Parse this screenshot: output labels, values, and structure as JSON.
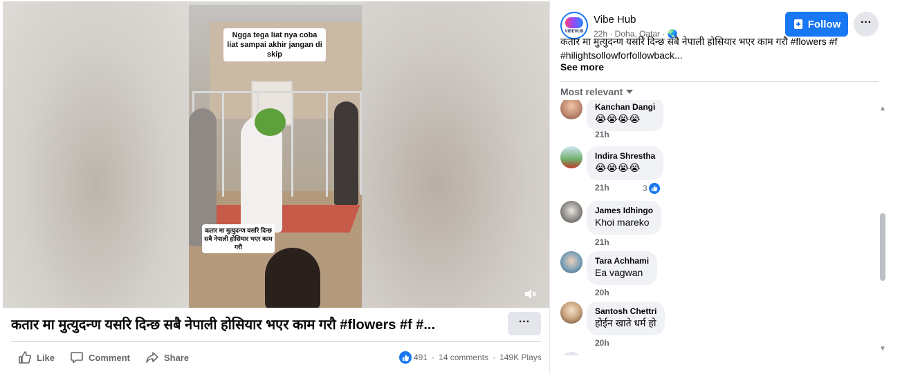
{
  "video": {
    "caption_top": "Ngga tega liat nya coba liat sampai akhir jangan di skip",
    "caption_bottom": "कतार मा मुत्युदन्ण यसरि दिन्छ सबै नेपाली होसियार भएर काम गरौ",
    "mute_icon": "speaker-muted-icon"
  },
  "post": {
    "title": "कतार मा मुत्युदन्ण यसरि दिन्छ सबै नेपाली होसियार भएर काम गरौ #flowers #f #...",
    "more_label": "···",
    "actions": {
      "like": "Like",
      "comment": "Comment",
      "share": "Share"
    },
    "stats": {
      "likes": "491",
      "comments": "14 comments",
      "plays": "149K Plays",
      "sep": "·"
    }
  },
  "page": {
    "name": "Vibe Hub",
    "avatar_brand": "VIBEHUB",
    "meta": "22h · Doha, Qatar · 🌏",
    "follow_label": "Follow",
    "more_label": "···",
    "description_line1": "कतार मा मुत्युदन्ण यसरि दिन्छ सबै नेपाली होसियार भएर काम गरौ #flowers #f",
    "description_line2": "#hilightsollowforfollowback...",
    "see_more": "See more"
  },
  "comments_section": {
    "sort_label": "Most relevant",
    "items": [
      {
        "name": "Kanchan Dangi",
        "text": "😭😭😭😭",
        "time": "21h"
      },
      {
        "name": "Indira Shrestha",
        "text": "😭😭😭😭",
        "time": "21h",
        "reactions": "3"
      },
      {
        "name": "James Idhingo",
        "text": "Khoi mareko",
        "time": "21h"
      },
      {
        "name": "Tara Achhami",
        "text": "Ea vagwan",
        "time": "20h"
      },
      {
        "name": "Santosh Chettri",
        "text": "होईन खाते धर्म हो",
        "time": "20h"
      }
    ]
  },
  "colors": {
    "accent": "#1877f2",
    "bubble": "#f0f2f5",
    "muted_text": "#65676b"
  }
}
